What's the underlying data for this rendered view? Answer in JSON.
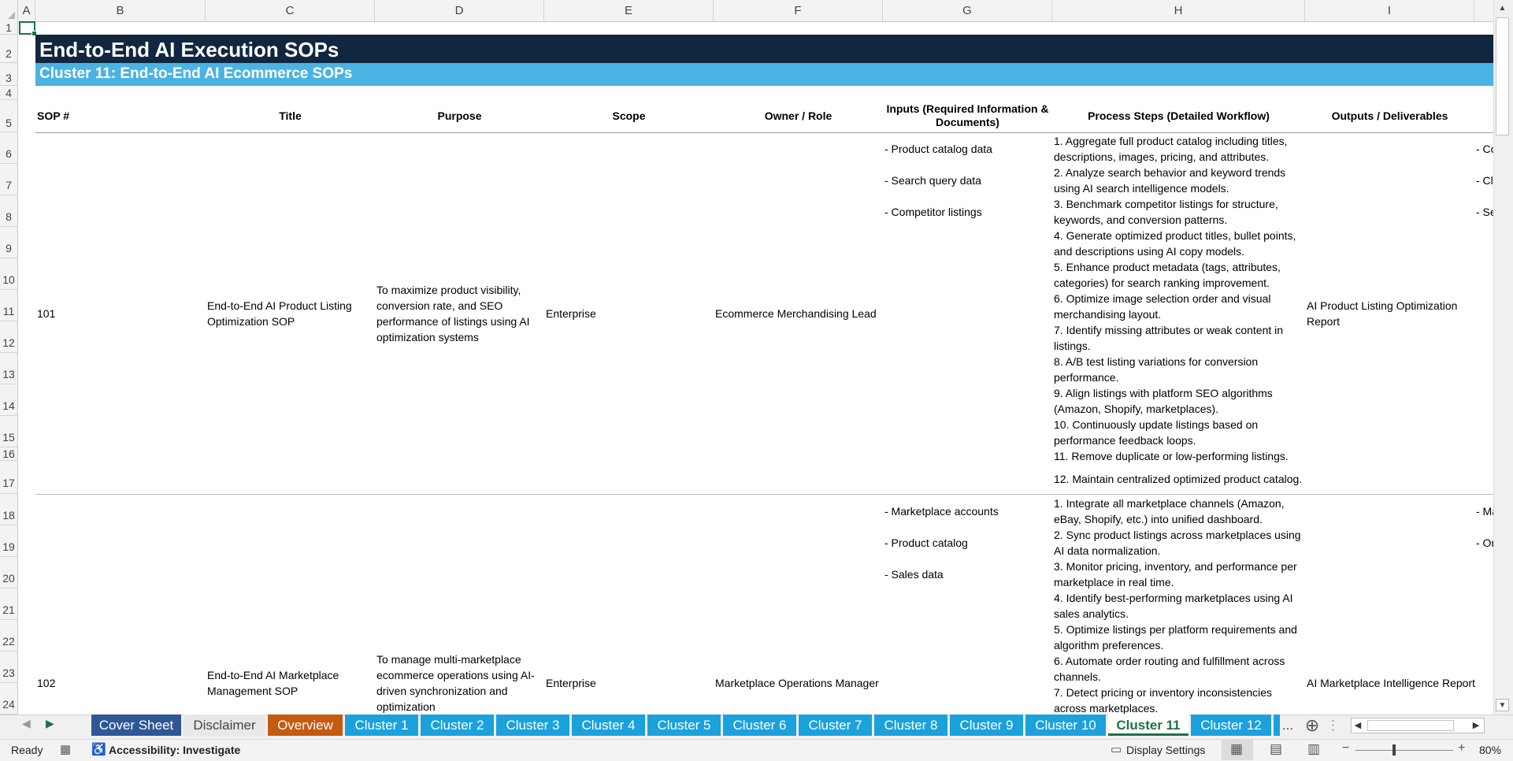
{
  "columns": [
    "A",
    "B",
    "C",
    "D",
    "E",
    "F",
    "G",
    "H",
    "I"
  ],
  "rows": [
    "1",
    "2",
    "3",
    "4",
    "5",
    "6",
    "7",
    "8",
    "9",
    "10",
    "11",
    "12",
    "13",
    "14",
    "15",
    "16",
    "17",
    "18",
    "19",
    "20",
    "21",
    "22",
    "23",
    "24"
  ],
  "banner": {
    "title": "End-to-End AI Execution SOPs",
    "subtitle": "Cluster 11: End-to-End AI Ecommerce SOPs"
  },
  "table": {
    "headers": {
      "sop": "SOP #",
      "title": "Title",
      "purpose": "Purpose",
      "scope": "Scope",
      "owner": "Owner / Role",
      "inputs_line1": "Inputs (Required Information &",
      "inputs_line2": "Documents)",
      "steps": "Process Steps (Detailed Workflow)",
      "outputs": "Outputs / Deliverables"
    },
    "rows": [
      {
        "sop": "101",
        "title_l1": "End-to-End AI Product Listing",
        "title_l2": "Optimization SOP",
        "purpose_l1": "To maximize product visibility,",
        "purpose_l2": "conversion rate, and SEO",
        "purpose_l3": "performance of listings using AI",
        "purpose_l4": "optimization systems",
        "scope": "Enterprise",
        "owner": "Ecommerce Merchandising Lead",
        "inputs": [
          "- Product catalog data",
          "- Search query data",
          "- Competitor listings"
        ],
        "steps": [
          "1. Aggregate full product catalog including titles,",
          "descriptions, images, pricing, and attributes.",
          "2. Analyze search behavior and keyword trends",
          "using AI search intelligence models.",
          "3. Benchmark competitor listings for structure,",
          "keywords, and conversion patterns.",
          "4. Generate optimized product titles, bullet points,",
          "and descriptions using AI copy models.",
          "5. Enhance product metadata (tags, attributes,",
          "categories) for search ranking improvement.",
          "6. Optimize image selection order and visual",
          "merchandising layout.",
          "7. Identify missing attributes or weak content in",
          "listings.",
          "8. A/B test listing variations for conversion",
          "performance.",
          "9. Align listings with platform SEO algorithms",
          "(Amazon, Shopify, marketplaces).",
          "10. Continuously update listings based on",
          "performance feedback loops.",
          "11. Remove duplicate or low-performing listings."
        ],
        "step_last": "12. Maintain centralized optimized product catalog.",
        "output_l1": "AI Product Listing Optimization",
        "output_l2": "Report",
        "overflow": [
          "- Co",
          "- Cl",
          "- Se"
        ]
      },
      {
        "sop": "102",
        "title_l1": "End-to-End AI Marketplace",
        "title_l2": "Management SOP",
        "purpose_l1": "To manage multi-marketplace",
        "purpose_l2": "ecommerce operations using AI-",
        "purpose_l3": "driven synchronization and",
        "purpose_l4": "optimization",
        "scope": "Enterprise",
        "owner": "Marketplace Operations Manager",
        "inputs": [
          "- Marketplace accounts",
          "- Product catalog",
          "- Sales data"
        ],
        "steps": [
          "1. Integrate all marketplace channels (Amazon,",
          "eBay, Shopify, etc.) into unified dashboard.",
          "2. Sync product listings across marketplaces using",
          "AI data normalization.",
          "3. Monitor pricing, inventory, and performance per",
          "marketplace in real time.",
          "4. Identify best-performing marketplaces using AI",
          "sales analytics.",
          "5. Optimize listings per platform requirements and",
          "algorithm preferences.",
          "6. Automate order routing and fulfillment across",
          "channels.",
          "7. Detect pricing or inventory inconsistencies",
          "across marketplaces."
        ],
        "output_l1": "AI Marketplace Intelligence Report",
        "overflow": [
          "- Ma",
          "- Or"
        ]
      }
    ]
  },
  "tabs": [
    {
      "label": "Cover Sheet",
      "bg": "#2e5796",
      "fg": "#ffffff"
    },
    {
      "label": "Disclaimer",
      "bg": "#e8e8e8",
      "fg": "#444444"
    },
    {
      "label": "Overview",
      "bg": "#c55a11",
      "fg": "#ffffff"
    },
    {
      "label": "Cluster 1",
      "bg": "#1ba1dc",
      "fg": "#ffffff"
    },
    {
      "label": "Cluster 2",
      "bg": "#1ba1dc",
      "fg": "#ffffff"
    },
    {
      "label": "Cluster 3",
      "bg": "#1ba1dc",
      "fg": "#ffffff"
    },
    {
      "label": "Cluster 4",
      "bg": "#1ba1dc",
      "fg": "#ffffff"
    },
    {
      "label": "Cluster 5",
      "bg": "#1ba1dc",
      "fg": "#ffffff"
    },
    {
      "label": "Cluster 6",
      "bg": "#1ba1dc",
      "fg": "#ffffff"
    },
    {
      "label": "Cluster 7",
      "bg": "#1ba1dc",
      "fg": "#ffffff"
    },
    {
      "label": "Cluster 8",
      "bg": "#1ba1dc",
      "fg": "#ffffff"
    },
    {
      "label": "Cluster 9",
      "bg": "#1ba1dc",
      "fg": "#ffffff"
    },
    {
      "label": "Cluster 10",
      "bg": "#1ba1dc",
      "fg": "#ffffff"
    },
    {
      "label": "Cluster 11",
      "bg": "#ffffff",
      "fg": "#1e7145"
    },
    {
      "label": "Cluster 12",
      "bg": "#1ba1dc",
      "fg": "#ffffff"
    }
  ],
  "tab_overflow": "...",
  "status": {
    "ready": "Ready",
    "accessibility": "Accessibility: Investigate",
    "display_settings": "Display Settings",
    "zoom": "80%"
  },
  "colors": {
    "banner_dark": "#112740",
    "banner_light": "#4bb3e3",
    "active_cell": "#1e7145"
  }
}
